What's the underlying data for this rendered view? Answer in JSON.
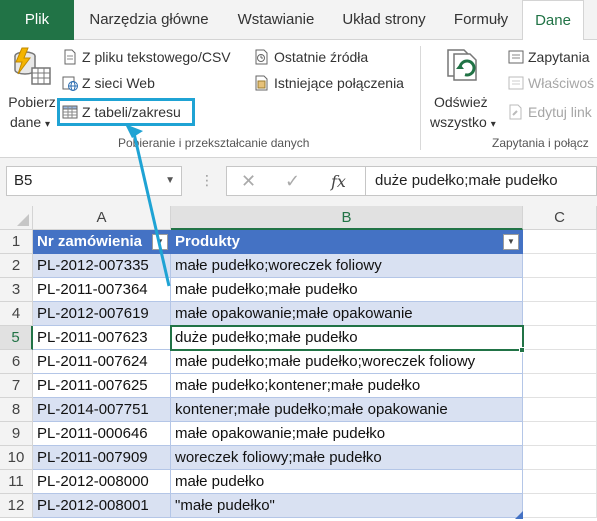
{
  "ribbon_tabs": {
    "file": "Plik",
    "home": "Narzędzia główne",
    "insert": "Wstawianie",
    "layout": "Układ strony",
    "formulas": "Formuły",
    "data": "Dane"
  },
  "get_data": {
    "line1": "Pobierz",
    "line2": "dane",
    "caret": "▾"
  },
  "get_transform": {
    "from_text": "Z pliku tekstowego/CSV",
    "from_web": "Z sieci Web",
    "from_table": "Z tabeli/zakresu",
    "recent_sources": "Ostatnie źródła",
    "existing_connections": "Istniejące połączenia",
    "group_label": "Pobieranie i przekształcanie danych"
  },
  "queries": {
    "refresh_line1": "Odśwież",
    "refresh_line2": "wszystko",
    "caret": "▾",
    "queries_label": "Zapytania",
    "properties_label": "Właściwoś",
    "edit_links_label": "Edytuj link",
    "group_label": "Zapytania i połącz"
  },
  "formula_bar": {
    "name_box": "B5",
    "cancel_symbol": "✕",
    "enter_symbol": "✓",
    "fx_symbol": "fx",
    "formula": "duże pudełko;małe pudełko"
  },
  "grid": {
    "columns": [
      "A",
      "B",
      "C"
    ],
    "header_row": {
      "row": "1",
      "a": "Nr zamówienia",
      "b": "Produkty"
    },
    "rows": [
      {
        "row": "2",
        "a": "PL-2012-007335",
        "b": "małe pudełko;woreczek foliowy"
      },
      {
        "row": "3",
        "a": "PL-2011-007364",
        "b": "małe pudełko;małe pudełko"
      },
      {
        "row": "4",
        "a": "PL-2012-007619",
        "b": "małe opakowanie;małe opakowanie"
      },
      {
        "row": "5",
        "a": "PL-2011-007623",
        "b": "duże pudełko;małe pudełko"
      },
      {
        "row": "6",
        "a": "PL-2011-007624",
        "b": "małe pudełko;małe pudełko;woreczek foliowy"
      },
      {
        "row": "7",
        "a": "PL-2011-007625",
        "b": "małe pudełko;kontener;małe pudełko"
      },
      {
        "row": "8",
        "a": "PL-2014-007751",
        "b": "kontener;małe pudełko;małe opakowanie"
      },
      {
        "row": "9",
        "a": "PL-2011-000646",
        "b": "małe opakowanie;małe pudełko"
      },
      {
        "row": "10",
        "a": "PL-2011-007909",
        "b": "woreczek foliowy;małe pudełko"
      },
      {
        "row": "11",
        "a": "PL-2012-008000",
        "b": "małe pudełko"
      },
      {
        "row": "12",
        "a": "PL-2012-008001",
        "b": "\"małe pudełko\""
      }
    ],
    "active_cell": "B5",
    "filter_glyph": "▼"
  },
  "colors": {
    "excel_green": "#217346",
    "table_header_blue": "#4472c4",
    "band_blue": "#d9e1f2",
    "callout_cyan": "#1fa3d4"
  }
}
